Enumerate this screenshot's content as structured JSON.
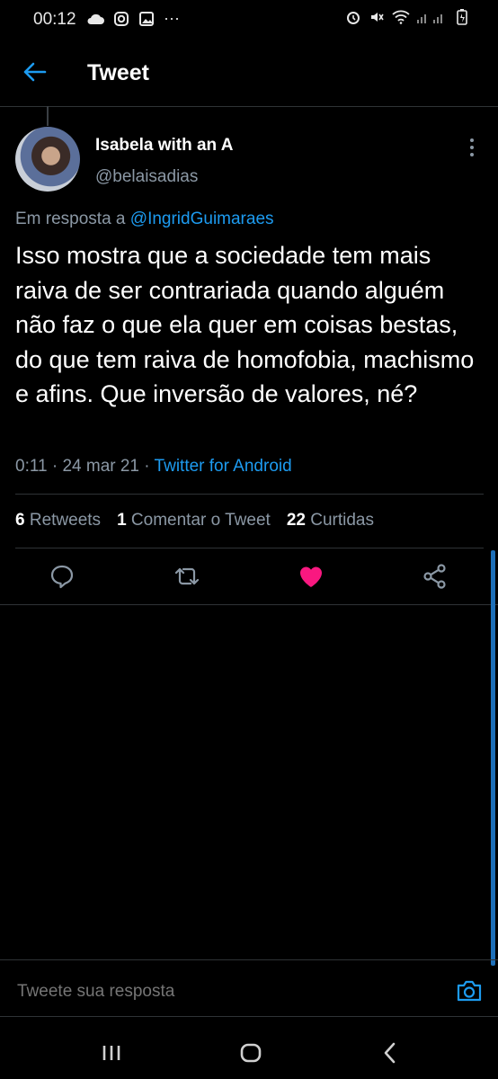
{
  "status_bar": {
    "time": "00:12",
    "dots": "···"
  },
  "header": {
    "title": "Tweet"
  },
  "tweet": {
    "author_name": "Isabela with an A",
    "author_handle": "@belaisadias",
    "reply_prefix": "Em resposta a ",
    "reply_mention": "@IngridGuimaraes",
    "text": "Isso mostra que a sociedade tem mais raiva de ser contrariada quando alguém não faz o que ela quer em coisas bestas, do que tem raiva de homofobia, machismo e afins. Que inversão de valores, né?",
    "timestamp": "0:11 · 24 mar 21 · ",
    "source": "Twitter for Android"
  },
  "stats": {
    "retweets_count": "6",
    "retweets_label": "Retweets",
    "quote_count": "1",
    "quote_label": "Comentar o Tweet",
    "likes_count": "22",
    "likes_label": "Curtidas"
  },
  "reply_box": {
    "placeholder": "Tweete sua resposta"
  },
  "colors": {
    "accent": "#1d9bf0",
    "like": "#f91880",
    "muted": "#8b98a5"
  },
  "icons": [
    "back-arrow-icon",
    "more-vertical-icon",
    "reply-icon",
    "retweet-icon",
    "heart-icon",
    "share-icon",
    "camera-icon"
  ]
}
